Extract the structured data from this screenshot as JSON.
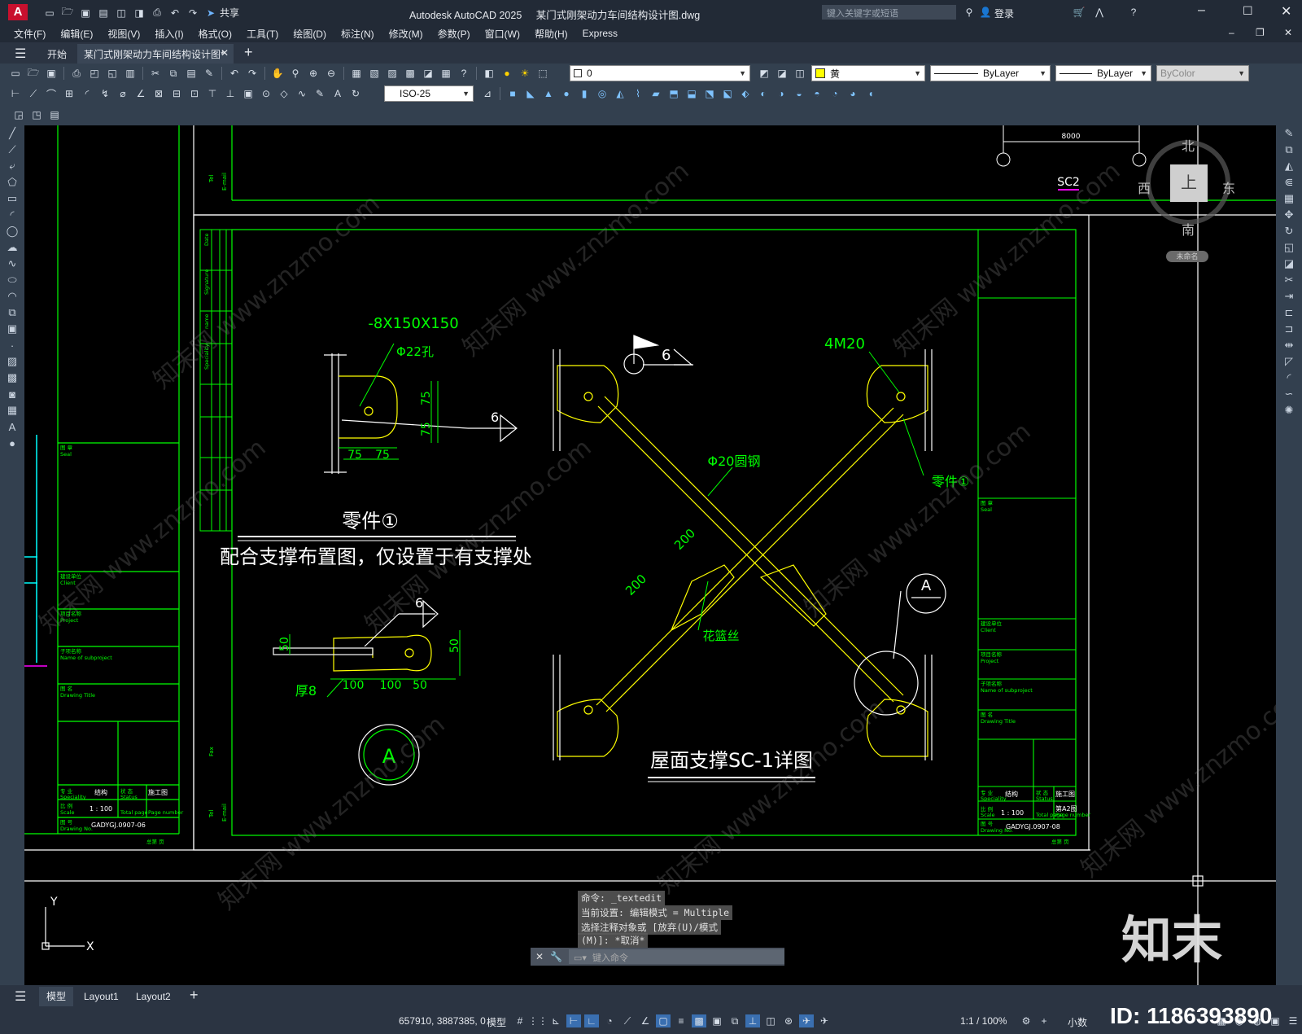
{
  "app": {
    "logo": "A",
    "title": "Autodesk AutoCAD 2025",
    "filename": "某门式刚架动力车间结构设计图.dwg",
    "share_label": "共享",
    "search_placeholder": "键入关键字或短语",
    "login_label": "登录"
  },
  "menus": [
    "文件(F)",
    "编辑(E)",
    "视图(V)",
    "插入(I)",
    "格式(O)",
    "工具(T)",
    "绘图(D)",
    "标注(N)",
    "修改(M)",
    "参数(P)",
    "窗口(W)",
    "帮助(H)",
    "Express"
  ],
  "tabs": {
    "start": "开始",
    "doc": "某门式刚架动力车间结构设计图*"
  },
  "layer": {
    "name": "0"
  },
  "props": {
    "color": "黄",
    "linetype": "ByLayer",
    "lineweight": "ByLayer",
    "plotstyle": "ByColor"
  },
  "dimstyle": "ISO-25",
  "viewcube": {
    "north": "北",
    "south": "南",
    "east": "东",
    "west": "西",
    "top": "上",
    "wcs": "未命名"
  },
  "drawing": {
    "part_plate": "-8X150X150",
    "hole": "Φ22孔",
    "dim_75_a": "75",
    "dim_75_b": "75",
    "dim_75_c": "75",
    "dim_75_d": "75",
    "weld_6": "6",
    "part_title": "零件①",
    "note": "配合支撑布置图，仅设置于有支撑处",
    "dim_50_a": "50",
    "dim_50_b": "50",
    "dim_100_a": "100",
    "dim_100_b": "100",
    "dim_50_c": "50",
    "thick": "厚8",
    "circle_a": "A",
    "weld_6b": "6",
    "weld_6c": "6",
    "bolts": "4M20",
    "rod": "Φ20圆钢",
    "part1": "零件①",
    "dim_200_a": "200",
    "dim_200_b": "200",
    "turnbuckle": "花篮丝",
    "detail_a": "A",
    "detail_title": "屋面支撑SC-1详图",
    "sc2": "SC2",
    "dim_8000": "8000",
    "drawing_no_left": "GADYGJ.0907-06",
    "drawing_no_right": "GADYGJ.0907-08",
    "scale_left": "1 : 100",
    "scale_right": "1 : 100",
    "spec_left": "结构",
    "status_left": "施工图",
    "spec_right": "结构",
    "status_right": "施工图",
    "rev_right": "第A2图",
    "seal": "图 章",
    "seal_en": "Seal",
    "client": "建设单位",
    "client_en": "Client",
    "project": "项目名称",
    "project_en": "Project",
    "subproject": "子项名称",
    "subproject_en": "Name of subproject",
    "drawing_title": "图 名",
    "drawing_title_en": "Drawing Title",
    "specialty": "专 业",
    "specialty_en": "Speciality",
    "status": "状 态",
    "status_en": "Status",
    "scale_lbl": "比 例",
    "scale_en": "Scale",
    "total_page": "Total page",
    "page_number": "Page number",
    "drawing_no": "图 号",
    "drawing_no_en": "Drawing No.",
    "sheet_of": "总第  页",
    "fax": "Fax",
    "tel": "Tel",
    "email": "E-mail",
    "col_date": "Date",
    "col_signature": "Signature",
    "col_name": "name",
    "col_speciality": "Speciality"
  },
  "commands": {
    "line1": "命令: _textedit",
    "line2": "当前设置: 编辑模式 = Multiple",
    "line3": "选择注释对象或 [放弃(U)/模式",
    "line4": "(M)]: *取消*",
    "input_placeholder": "键入命令"
  },
  "ucs": {
    "x": "X",
    "y": "Y"
  },
  "layout_tabs": [
    "模型",
    "Layout1",
    "Layout2"
  ],
  "status": {
    "coords": "657910, 3887385, 0",
    "model": "模型",
    "scale": "1:1 / 100%",
    "units": "小数"
  },
  "overlay": {
    "brand": "知末",
    "id": "ID: 1186393890",
    "watermark": "知末网 www.znzmo.com"
  },
  "colors": {
    "drawing_green": "#00ff00",
    "drawing_yellow": "#ffff00",
    "drawing_white": "#ffffff",
    "ui_dark": "#222a36"
  }
}
